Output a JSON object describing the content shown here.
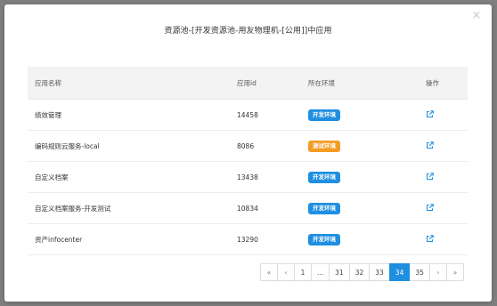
{
  "dialog": {
    "title": "资源池-[开发资源池-用友物理机-[公用]]中应用",
    "close": "×"
  },
  "table": {
    "headers": {
      "name": "应用名称",
      "id": "应用id",
      "env": "所在环境",
      "op": "操作"
    },
    "rows": [
      {
        "name": "绩效管理",
        "id": "14458",
        "env": "开发环境",
        "env_type": "dev"
      },
      {
        "name": "编码规则云服务-local",
        "id": "8086",
        "env": "测试环境",
        "env_type": "test"
      },
      {
        "name": "自定义档案",
        "id": "13438",
        "env": "开发环境",
        "env_type": "dev"
      },
      {
        "name": "自定义档案服务-开发测试",
        "id": "10834",
        "env": "开发环境",
        "env_type": "dev"
      },
      {
        "name": "资产infocenter",
        "id": "13290",
        "env": "开发环境",
        "env_type": "dev"
      }
    ]
  },
  "pagination": {
    "first": "«",
    "prev": "‹",
    "pages": [
      "1",
      "...",
      "31",
      "32",
      "33",
      "34",
      "35"
    ],
    "active": "34",
    "next": "›",
    "last": "»"
  },
  "colors": {
    "dev_badge": "#1e8fe1",
    "test_badge": "#f39c24",
    "active_page": "#1e8fe1"
  },
  "icons": {
    "close": "close-icon",
    "operation": "external-link-icon"
  }
}
